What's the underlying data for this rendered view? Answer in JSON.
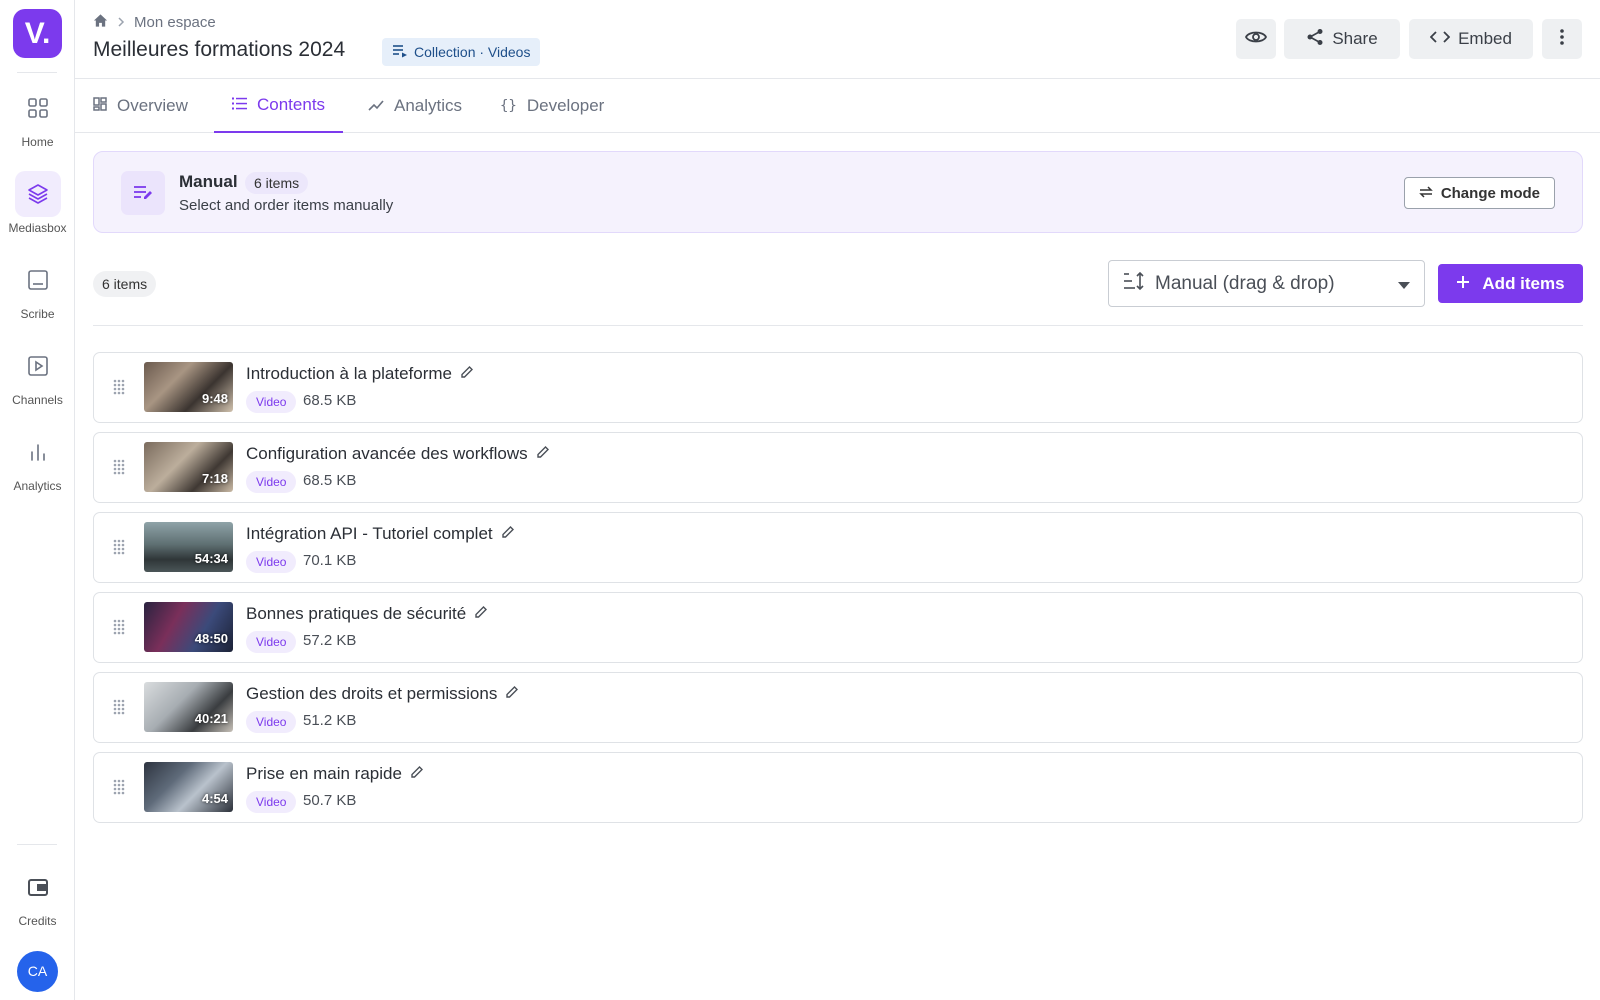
{
  "sidebar": {
    "logo": "V.",
    "items": [
      {
        "label": "Home",
        "icon": "grid-icon",
        "active": false
      },
      {
        "label": "Mediasbox",
        "icon": "layers-icon",
        "active": true
      },
      {
        "label": "Scribe",
        "icon": "caption-icon",
        "active": false
      },
      {
        "label": "Channels",
        "icon": "play-icon",
        "active": false
      },
      {
        "label": "Analytics",
        "icon": "bar-chart-icon",
        "active": false
      }
    ],
    "credits_label": "Credits",
    "avatar_initials": "CA"
  },
  "header": {
    "breadcrumb": "Mon espace",
    "title": "Meilleures formations 2024",
    "type_badge": "Collection · Videos",
    "share_label": "Share",
    "embed_label": "Embed"
  },
  "tabs": [
    {
      "label": "Overview",
      "icon": "dashboard-icon",
      "active": false
    },
    {
      "label": "Contents",
      "icon": "list-icon",
      "active": true
    },
    {
      "label": "Analytics",
      "icon": "trend-icon",
      "active": false
    },
    {
      "label": "Developer",
      "icon": "braces-icon",
      "active": false
    }
  ],
  "mode": {
    "title": "Manual",
    "count": "6 items",
    "description": "Select and order items manually",
    "change_label": "Change mode"
  },
  "toolbar": {
    "count": "6 items",
    "sort_value": "Manual (drag & drop)",
    "add_label": "Add items"
  },
  "items": [
    {
      "title": "Introduction à la plateforme",
      "type": "Video",
      "size": "68.5 KB",
      "duration": "9:48"
    },
    {
      "title": "Configuration avancée des workflows",
      "type": "Video",
      "size": "68.5 KB",
      "duration": "7:18"
    },
    {
      "title": "Intégration API - Tutoriel complet",
      "type": "Video",
      "size": "70.1 KB",
      "duration": "54:34"
    },
    {
      "title": "Bonnes pratiques de sécurité",
      "type": "Video",
      "size": "57.2 KB",
      "duration": "48:50"
    },
    {
      "title": "Gestion des droits et permissions",
      "type": "Video",
      "size": "51.2 KB",
      "duration": "40:21"
    },
    {
      "title": "Prise en main rapide",
      "type": "Video",
      "size": "50.7 KB",
      "duration": "4:54"
    }
  ],
  "colors": {
    "accent": "#7c3aed",
    "accent_soft": "#f1ecfd",
    "avatar": "#2563eb"
  }
}
